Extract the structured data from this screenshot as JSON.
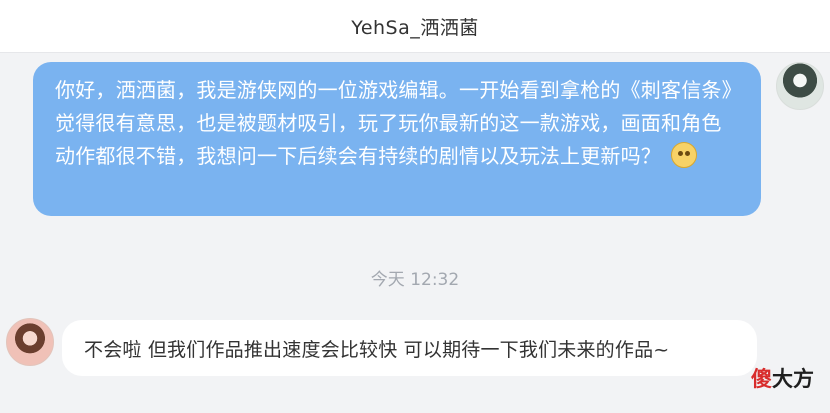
{
  "header": {
    "title": "YehSa_洒洒菌"
  },
  "messages": {
    "outgoing": {
      "text": "你好，洒洒菌，我是游侠网的一位游戏编辑。一开始看到拿枪的《刺客信条》觉得很有意思，也是被题材吸引，玩了玩你最新的这一款游戏，画面和角色动作都很不错，我想问一下后续会有持续的剧情以及玩法上更新吗？",
      "emoji": "blushing-smiley-emoji"
    },
    "timestamp": "今天 12:32",
    "incoming": {
      "text": "不会啦 但我们作品推出速度会比较快 可以期待一下我们未来的作品~"
    }
  },
  "watermark": {
    "part1": "傻",
    "part2": "大方"
  },
  "colors": {
    "outgoing_bubble": "#7ab3f0",
    "incoming_bubble": "#ffffff",
    "background": "#f2f3f5",
    "header": "#ffffff"
  }
}
